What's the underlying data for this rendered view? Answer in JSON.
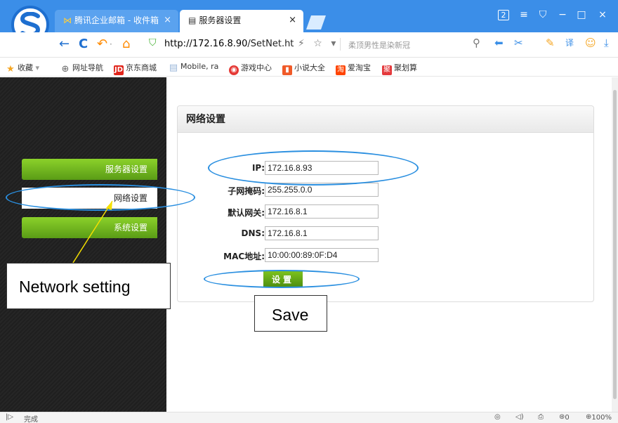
{
  "tabs": {
    "mail": {
      "label": "腾讯企业邮箱 - 收件箱",
      "close": "×"
    },
    "settings": {
      "label": "服务器设置",
      "close": "×"
    }
  },
  "window": {
    "badge": "2",
    "menu": "≡",
    "skin": "⛉",
    "minimize": "−",
    "maximize": "□",
    "close": "×"
  },
  "toolbar": {
    "back": "←",
    "reload": "C",
    "undo": "↶",
    "undo_more": "·",
    "home": "⌂",
    "url_host": "http://172.16.8.90",
    "url_path": "/SetNet.ht",
    "lightning": "⚡",
    "star": "☆",
    "dropdown": "▾",
    "hint": "柔顶男性是染新冠",
    "search": "⚲",
    "ext1": "⬅",
    "scissors": "✂",
    "key": "✎",
    "translate": "译",
    "emoji": "☺",
    "download": "⤓"
  },
  "bookmarks": [
    {
      "label": "收藏",
      "icon": "★",
      "color": "#f5a623",
      "suffix": " ▾"
    },
    {
      "label": "网址导航",
      "icon": "⊕",
      "color": "#666666",
      "suffix": ""
    },
    {
      "label": "京东商城",
      "icon": "JD",
      "color": "#e1251b",
      "suffix": ""
    },
    {
      "label": "Mobile, ra",
      "icon": "▤",
      "color": "#9bb7d9",
      "suffix": ""
    },
    {
      "label": "游戏中心",
      "icon": "◉",
      "color": "#e53935",
      "suffix": ""
    },
    {
      "label": "小说大全",
      "icon": "▮",
      "color": "#f05a28",
      "suffix": ""
    },
    {
      "label": "爱淘宝",
      "icon": "淘",
      "color": "#ff4400",
      "suffix": ""
    },
    {
      "label": "聚划算",
      "icon": "聚",
      "color": "#e4393c",
      "suffix": ""
    }
  ],
  "sidebar": {
    "items": [
      {
        "label": "服务器设置"
      },
      {
        "label": "网络设置"
      },
      {
        "label": "系统设置"
      }
    ]
  },
  "panel": {
    "title": "网络设置",
    "fields": [
      {
        "label": "IP:",
        "value": "172.16.8.93"
      },
      {
        "label": "子网掩码:",
        "value": "255.255.0.0"
      },
      {
        "label": "默认网关:",
        "value": "172.16.8.1"
      },
      {
        "label": "DNS:",
        "value": "172.16.8.1"
      },
      {
        "label": "MAC地址:",
        "value": "10:00:00:89:0F:D4"
      }
    ],
    "save_label": "设置"
  },
  "annotations": {
    "network_setting": "Network setting",
    "save": "Save",
    "color": "#2a8fe0",
    "arrow_color": "#f5e000"
  },
  "status": {
    "left_icon": "|▷",
    "text": "完成",
    "shield": "◎",
    "sound": "◁)",
    "print": "⎙",
    "ad_count": "0",
    "zoom": "100%"
  }
}
